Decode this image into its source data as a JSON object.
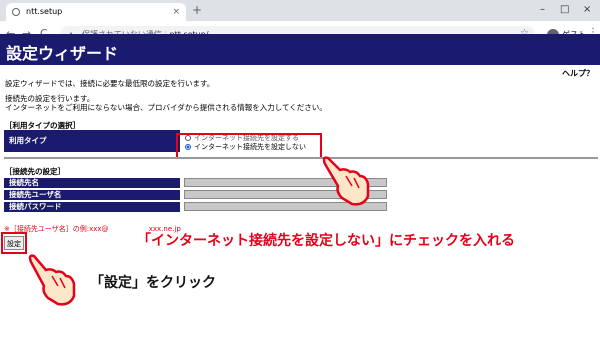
{
  "browser": {
    "tab_title": "ntt.setup",
    "tab_close": "×",
    "new_tab": "+",
    "minimize": "–",
    "restore": "□",
    "close": "×",
    "back": "←",
    "forward": "→",
    "reload": "C",
    "security_label": "保護されていない通信",
    "url": "ntt.setup/",
    "guest_label": "ゲスト",
    "menu": "⋮"
  },
  "page": {
    "title": "設定ウィザード",
    "help": "ヘルプ？",
    "intro": "設定ウィザードでは、接続に必要な最低限の設定を行います。",
    "desc_line1": "接続先の設定を行います。",
    "desc_line2": "インターネットをご利用にならない場合、プロバイダから提供される情報を入力してください。",
    "usage_section": "［利用タイプの選択］",
    "usage_label": "利用タイプ",
    "radio_set": "インターネット接続先を設定する",
    "radio_not_set": "インターネット接続先を設定しない",
    "connection_section": "［接続先の設定］",
    "fields": [
      {
        "label": "接続先名"
      },
      {
        "label": "接続先ユーザ名"
      },
      {
        "label": "接続パスワード"
      }
    ],
    "note": "※［接続先ユーザ名］の例:xxx@",
    "note_tail": "xxx.ne.jp",
    "submit_label": "設定"
  },
  "annotations": {
    "check_instruction": "「インターネット接続先を設定しない」にチェックを入れる",
    "click_instruction": "「設定」をクリック",
    "accent_color": "#e6001a"
  }
}
